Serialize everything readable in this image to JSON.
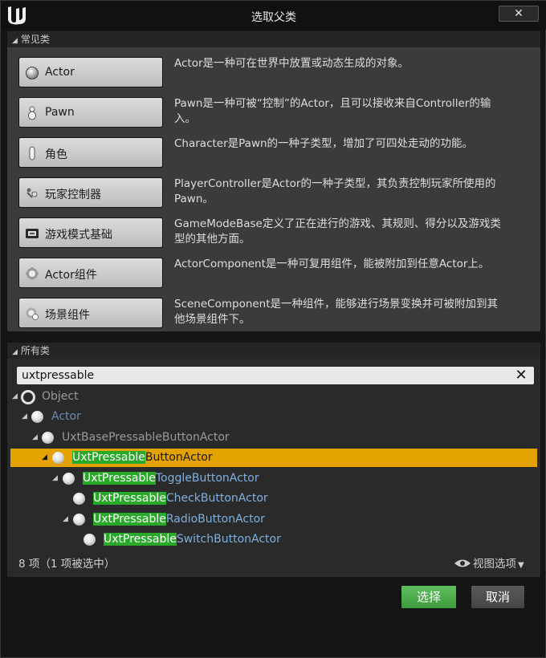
{
  "window": {
    "title": "选取父类",
    "close_label": "✕"
  },
  "common": {
    "header": "常见类",
    "items": [
      {
        "label": "Actor",
        "icon": "actor-sphere-icon",
        "desc": "Actor是一种可在世界中放置或动态生成的对象。"
      },
      {
        "label": "Pawn",
        "icon": "pawn-icon",
        "desc": "Pawn是一种可被“控制”的Actor，且可以接收来自Controller的输入。"
      },
      {
        "label": "角色",
        "icon": "character-icon",
        "desc": "Character是Pawn的一种子类型，增加了可四处走动的功能。"
      },
      {
        "label": "玩家控制器",
        "icon": "player-controller-icon",
        "desc": "PlayerController是Actor的一种子类型，其负责控制玩家所使用的Pawn。"
      },
      {
        "label": "游戏模式基础",
        "icon": "game-mode-icon",
        "desc": "GameModeBase定义了正在进行的游戏、其规则、得分以及游戏类型的其他方面。"
      },
      {
        "label": "Actor组件",
        "icon": "actor-component-icon",
        "desc": "ActorComponent是一种可复用组件，能被附加到任意Actor上。"
      },
      {
        "label": "场景组件",
        "icon": "scene-component-icon",
        "desc": "SceneComponent是一种组件，能够进行场景变换并可被附加到其他场景组件下。"
      }
    ]
  },
  "all_classes": {
    "header": "所有类",
    "search_value": "uxtpressable",
    "search_match": "UxtPressable",
    "tree": [
      {
        "label": "Object",
        "match": "",
        "rest": "Object"
      },
      {
        "label": "Actor",
        "match": "",
        "rest": "Actor"
      },
      {
        "label": "UxtBasePressableButtonActor",
        "match": "",
        "rest": "UxtBasePressableButtonActor"
      },
      {
        "label": "UxtPressableButtonActor",
        "match": "UxtPressable",
        "rest": "ButtonActor"
      },
      {
        "label": "UxtPressableToggleButtonActor",
        "match": "UxtPressable",
        "rest": "ToggleButtonActor"
      },
      {
        "label": "UxtPressableCheckButtonActor",
        "match": "UxtPressable",
        "rest": "CheckButtonActor"
      },
      {
        "label": "UxtPressableRadioButtonActor",
        "match": "UxtPressable",
        "rest": "RadioButtonActor"
      },
      {
        "label": "UxtPressableSwitchButtonActor",
        "match": "UxtPressable",
        "rest": "SwitchButtonActor"
      }
    ],
    "selected_index": 3,
    "count_text": "8 项（1 项被选中）",
    "view_options": "视图选项"
  },
  "buttons": {
    "select": "选择",
    "cancel": "取消"
  },
  "colors": {
    "selected_row": "#e3a200",
    "search_highlight": "#2aa82a",
    "select_button": "#4caf4c"
  }
}
